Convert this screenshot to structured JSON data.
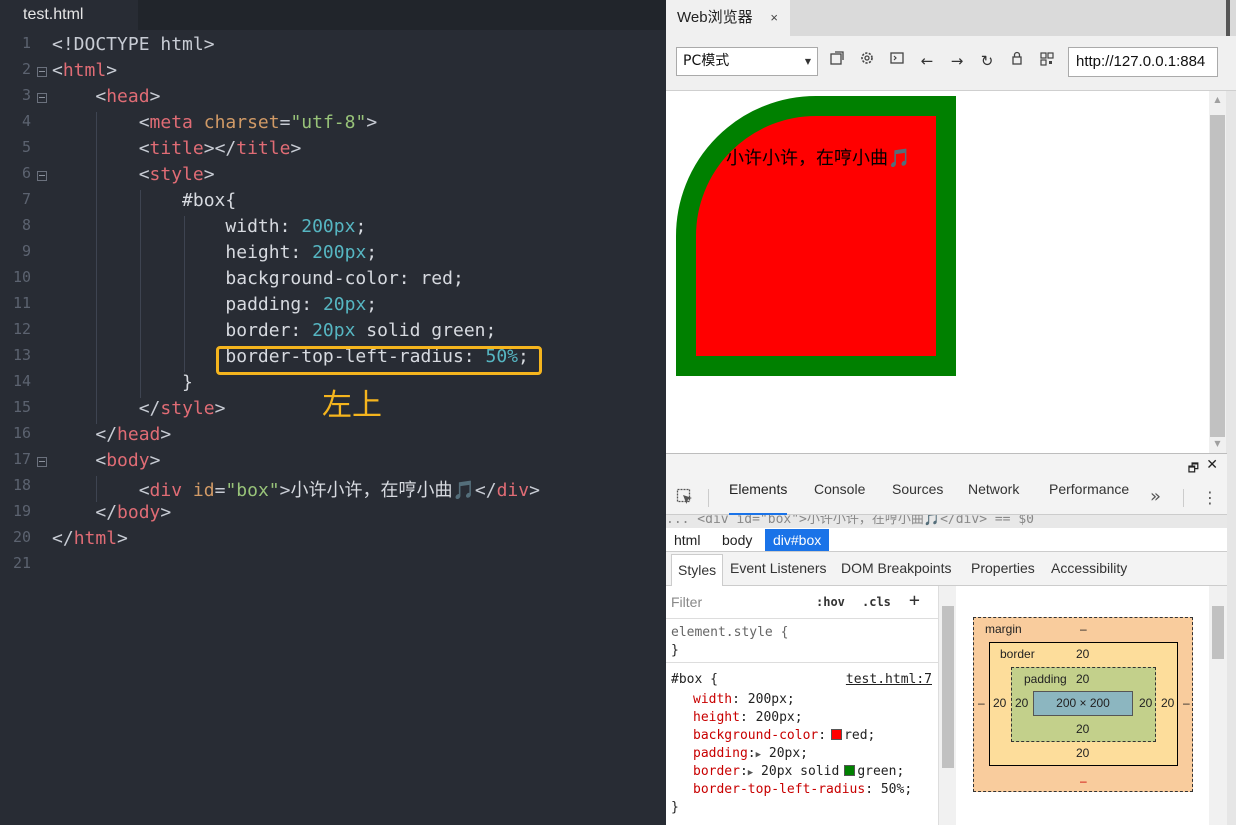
{
  "editor": {
    "tab_title": "test.html",
    "line_numbers": [
      "1",
      "2",
      "3",
      "4",
      "5",
      "6",
      "7",
      "8",
      "9",
      "10",
      "11",
      "12",
      "13",
      "14",
      "15",
      "16",
      "17",
      "18",
      "19",
      "20",
      "21"
    ],
    "annotation": "左上"
  },
  "browser": {
    "tab_title": "Web浏览器",
    "tab_close": "×",
    "mode_select": "PC模式",
    "url": "http://127.0.0.1:884",
    "page_text": "小许小许，在哼小曲🎵"
  },
  "devtools": {
    "undock_icon": "🗗",
    "close_icon": "✕",
    "tabs": [
      "Elements",
      "Console",
      "Sources",
      "Network",
      "Performance"
    ],
    "more": "»",
    "menu": "⋮",
    "dom_line": "... <div id=\"box\">小许小许，在哼小曲🎵</div> == $0",
    "breadcrumbs": [
      "html",
      "body",
      "div#box"
    ],
    "subtabs": [
      "Styles",
      "Event Listeners",
      "DOM Breakpoints",
      "Properties",
      "Accessibility"
    ],
    "filter_placeholder": "Filter",
    "hov": ":hov",
    "cls": ".cls",
    "add": "+",
    "element_style": "element.style {",
    "close_brace": "}",
    "rule_selector": "#box {",
    "rule_source": "test.html:7",
    "declarations": [
      {
        "prop": "width",
        "value": "200px;"
      },
      {
        "prop": "height",
        "value": "200px;"
      },
      {
        "prop": "background-color",
        "value": "red;",
        "swatch": "#ff0000"
      },
      {
        "prop": "padding",
        "value": "20px;",
        "expand": true
      },
      {
        "prop": "border",
        "value": "20px solid",
        "swatch": "#008000",
        "value2": "green;",
        "expand": true
      },
      {
        "prop": "border-top-left-radius",
        "value": "50%;"
      }
    ],
    "box_model": {
      "margin_label": "margin",
      "margin_top": "–",
      "margin_bottom": "–",
      "margin_left": "–",
      "margin_right": "–",
      "border_label": "border",
      "border_top": "20",
      "border_bottom": "20",
      "border_left": "20",
      "border_right": "20",
      "padding_label": "padding",
      "padding_top": "20",
      "padding_bottom": "20",
      "padding_left": "20",
      "padding_right": "20",
      "content": "200 × 200"
    }
  },
  "colors": {
    "accent": "#1a73e8",
    "highlight": "#f5b51e",
    "box_bg": "#ff0000",
    "box_border": "#008000"
  }
}
